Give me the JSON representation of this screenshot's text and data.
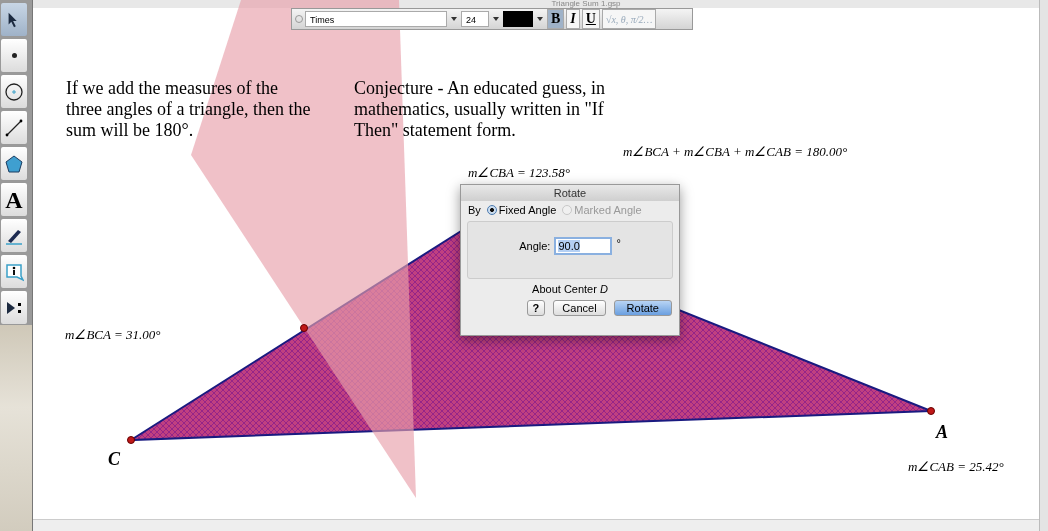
{
  "window": {
    "title": "Triangle Sum 1.gsp"
  },
  "tools": [
    {
      "kind": "arrow",
      "selected": true
    },
    {
      "kind": "point",
      "selected": false
    },
    {
      "kind": "compass",
      "selected": false
    },
    {
      "kind": "line",
      "selected": false
    },
    {
      "kind": "polygon",
      "selected": false
    },
    {
      "kind": "text",
      "glyph": "A",
      "selected": false
    },
    {
      "kind": "marker",
      "selected": false
    },
    {
      "kind": "info",
      "selected": false
    },
    {
      "kind": "custom",
      "selected": false
    }
  ],
  "format_toolbar": {
    "font": "Times",
    "size": "24",
    "bold": true,
    "italic": false,
    "underline": false,
    "bold_label": "B",
    "italic_label": "I",
    "underline_label": "U",
    "math_label": "√x, θ, π/2…"
  },
  "texts": [
    {
      "kind": "paragraph",
      "text": "If we add the measures of the three angles of a triangle, then the sum will be 180°."
    },
    {
      "kind": "conjecture",
      "text": "Conjecture - An educated guess, in mathematics, usually written in \"If Then\" statement form."
    }
  ],
  "measurements": [
    {
      "kind": "sum",
      "text": "m∠BCA + m∠CBA + m∠CAB = 180.00°"
    },
    {
      "kind": "cba",
      "text": "m∠CBA = 123.58°"
    },
    {
      "kind": "bca",
      "text": "m∠BCA = 31.00°"
    },
    {
      "kind": "cab",
      "text": "m∠CAB = 25.42°"
    }
  ],
  "points": [
    {
      "label": "C"
    },
    {
      "label": "A"
    }
  ],
  "dialog": {
    "title": "Rotate",
    "by_label": "By",
    "options": [
      {
        "label": "Fixed Angle",
        "selected": true,
        "disabled": false
      },
      {
        "label": "Marked Angle",
        "selected": false,
        "disabled": true
      }
    ],
    "angle_label": "Angle:",
    "angle_value": "90.0",
    "unit": "°",
    "center": "About Center *D*",
    "buttons": [
      {
        "kind": "help",
        "label": "?"
      },
      {
        "kind": "cancel",
        "label": "Cancel"
      },
      {
        "kind": "default",
        "label": "Rotate"
      }
    ]
  }
}
